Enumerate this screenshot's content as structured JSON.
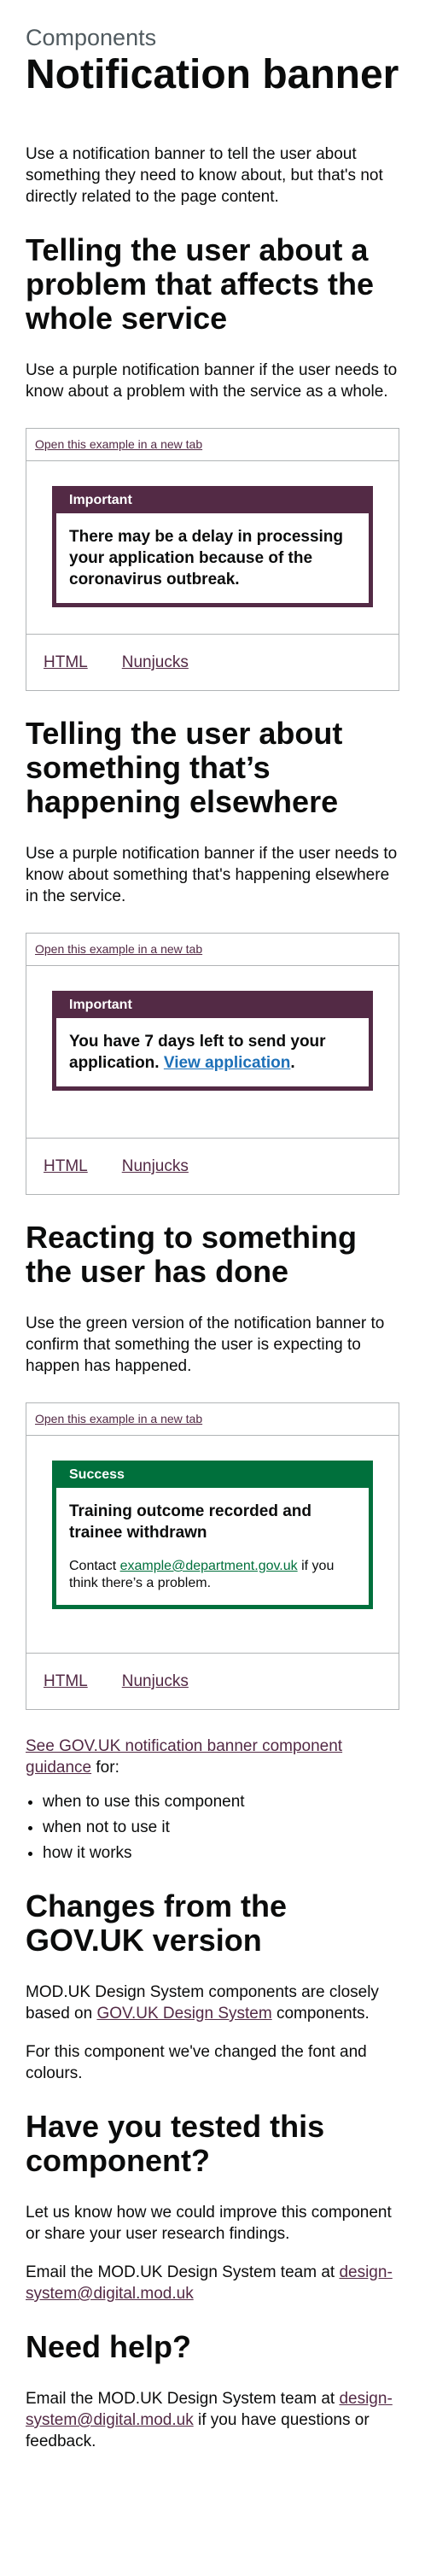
{
  "header": {
    "caption": "Components",
    "title": "Notification banner"
  },
  "intro": "Use a notification banner to tell the user about something they need to know about, but that's not directly related to the page content.",
  "sections": [
    {
      "heading": "Telling the user about a problem that affects the whole service",
      "description": "Use a purple notification banner if the user needs to know about a problem with the service as a whole.",
      "open_link": "Open this example in a new tab",
      "banner": {
        "title": "Important",
        "heading": "There may be a delay in processing your application because of the coronavirus outbreak."
      },
      "tabs": [
        "HTML",
        "Nunjucks"
      ]
    },
    {
      "heading": "Telling the user about something that’s happening elsewhere",
      "description": "Use a purple notification banner if the user needs to know about something that's happening elsewhere in the service.",
      "open_link": "Open this example in a new tab",
      "banner": {
        "title": "Important",
        "heading_text": "You have 7 days left to send your application.",
        "heading_link": "View application"
      },
      "tabs": [
        "HTML",
        "Nunjucks"
      ]
    },
    {
      "heading": "Reacting to something the user has done",
      "description": "Use the green version of the notification banner to confirm that something the user is expecting to happen has happened.",
      "open_link": "Open this example in a new tab",
      "banner": {
        "title": "Success",
        "heading": "Training outcome recorded and trainee withdrawn",
        "body_prefix": "Contact",
        "body_link": "example@department.gov.uk",
        "body_suffix": "if you think there’s a problem."
      },
      "tabs": [
        "HTML",
        "Nunjucks"
      ]
    }
  ],
  "guidance": {
    "link": "See GOV.UK notification banner component guidance",
    "suffix": "for:",
    "items": [
      "when to use this component",
      "when not to use it",
      "how it works"
    ]
  },
  "changes": {
    "heading": "Changes from the GOV.UK version",
    "p1_prefix": "MOD.UK Design System components are closely based on",
    "p1_link": "GOV.UK Design System",
    "p1_suffix": "components.",
    "p2": "For this component we've changed the font and colours."
  },
  "tested": {
    "heading": "Have you tested this component?",
    "p1": "Let us know how we could improve this component or share your user research findings.",
    "p2_prefix": "Email the MOD.UK Design System team at",
    "p2_link": "design-system@digital.mod.uk"
  },
  "help": {
    "heading": "Need help?",
    "prefix": "Email the MOD.UK Design System team at",
    "link": "design-system@digital.mod.uk",
    "suffix": "if you have questions or feedback."
  },
  "colors": {
    "important": "#532a45",
    "success": "#00703c",
    "link": "#532a45",
    "banner_link": "#1d70b8"
  }
}
